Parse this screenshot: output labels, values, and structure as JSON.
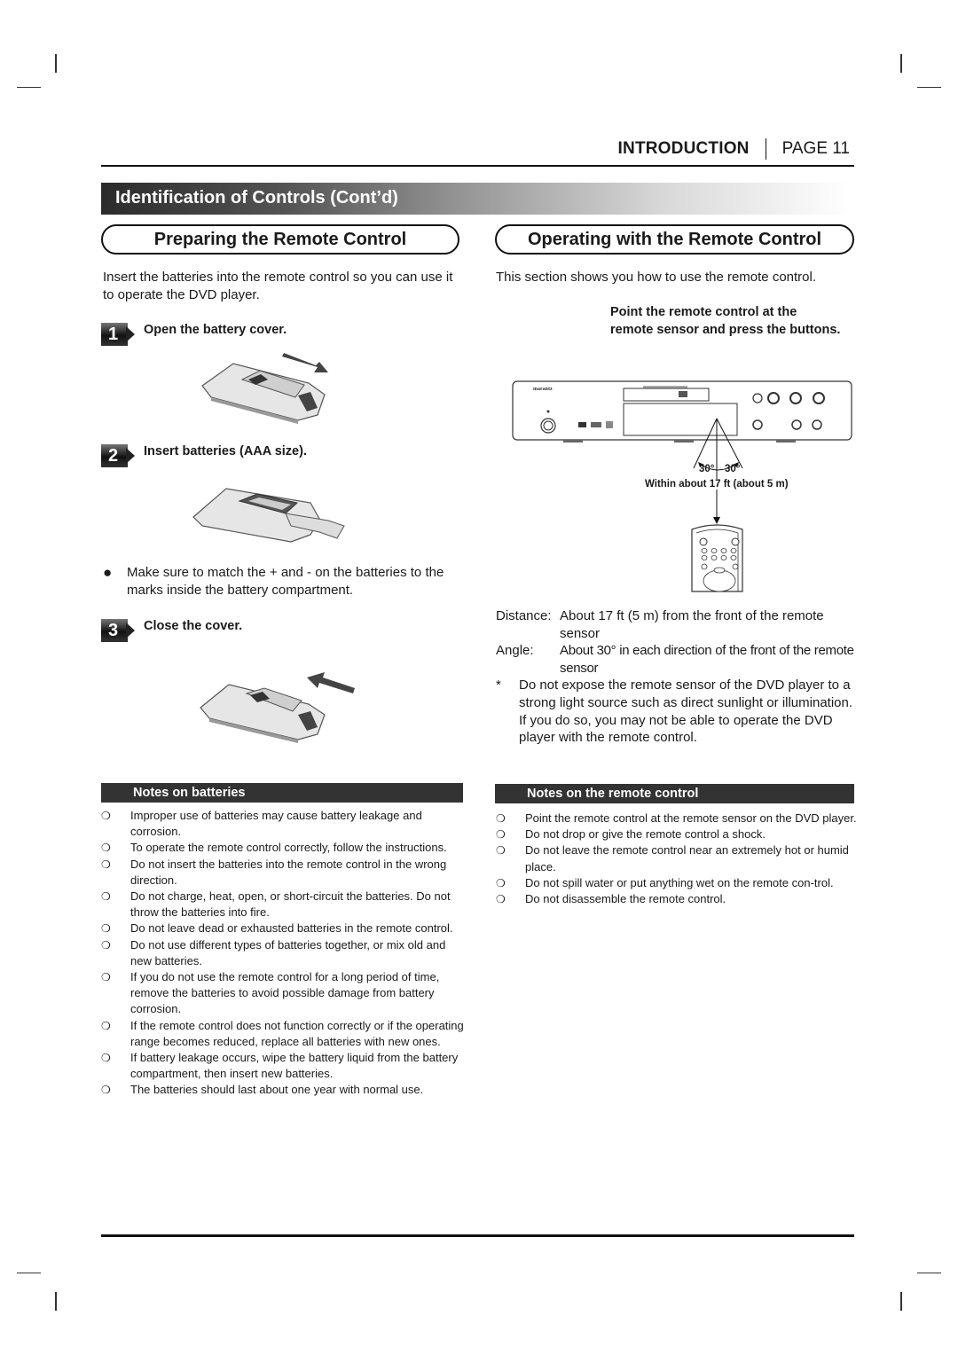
{
  "header": {
    "section": "INTRODUCTION",
    "page": "PAGE 11"
  },
  "band_title": "Identification of Controls (Cont’d)",
  "left": {
    "title": "Preparing the Remote Control",
    "intro": "Insert the batteries into the remote control so you can use it to operate the DVD player.",
    "steps": [
      {
        "number": "1",
        "text": "Open the battery cover."
      },
      {
        "number": "2",
        "text": "Insert batteries (AAA size)."
      },
      {
        "number": "3",
        "text": "Close the cover."
      }
    ],
    "bullet_note": "Make sure to match the + and - on the batteries to the marks inside the battery compartment.",
    "notes_title": "Notes on batteries",
    "notes": [
      "Improper use of batteries may cause battery leakage and corrosion.",
      "To operate the remote control correctly, follow the instructions.",
      "Do not insert the batteries into the remote control in the wrong direction.",
      "Do not charge, heat, open, or short-circuit the batteries. Do not throw the batteries into fire.",
      "Do not leave dead or exhausted batteries in the remote control.",
      "Do not use different types of batteries together, or mix old and new batteries.",
      "If you do not use the remote control for a long period of time, remove the batteries to avoid possible damage from battery corrosion.",
      "If the remote control does not function correctly or if the operating range becomes reduced, replace all batteries with new ones.",
      "If battery leakage occurs, wipe the battery liquid from the battery compartment, then insert new batteries.",
      "The batteries should last about one year with normal use."
    ]
  },
  "right": {
    "title": "Operating with the Remote Control",
    "intro": "This section shows you how to use the remote control.",
    "instruction": "Point the remote control at the remote sensor and press the buttons.",
    "diagram": {
      "angle_left": "30°",
      "angle_right": "30°",
      "range_label": "Within about 17 ft (about 5 m)",
      "brand": "marantz"
    },
    "specs": [
      {
        "label": "Distance:",
        "value": "About 17 ft (5 m) from the front of the remote sensor"
      },
      {
        "label": "Angle:",
        "value": "About 30° in each direction of the front of the remote sensor"
      }
    ],
    "caution_mark": "*",
    "caution": "Do not expose the remote sensor of the DVD player to a strong light source such as direct sunlight or illumination. If you do so, you may not be able to operate the DVD player with the remote control.",
    "notes_title": "Notes on the remote control",
    "notes": [
      "Point the remote control at the remote sensor on the DVD player.",
      "Do not drop or give the remote control a shock.",
      "Do not leave the remote control near an extremely hot or humid place.",
      "Do not spill water or put anything wet on the remote con-trol.",
      "Do not disassemble the remote control."
    ]
  },
  "bullet_glyph": "❍"
}
